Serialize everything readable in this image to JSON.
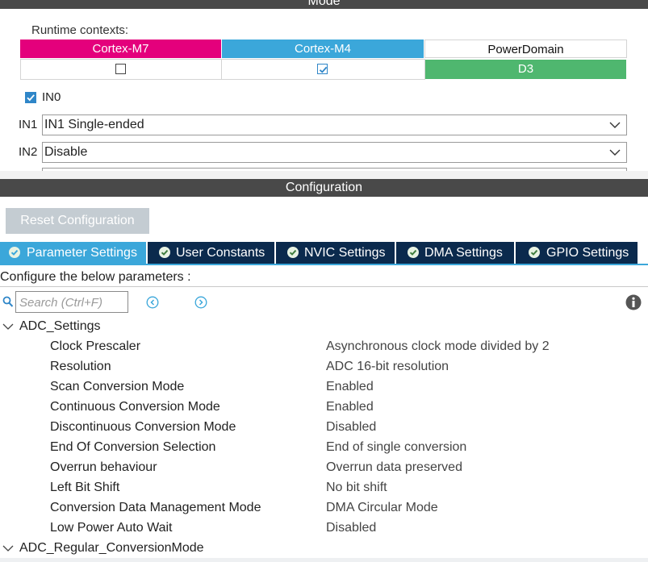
{
  "mode": {
    "title": "Mode",
    "runtime_label": "Runtime contexts:",
    "contexts": [
      {
        "name": "Cortex-M7",
        "color": "#e4007c",
        "checked": false
      },
      {
        "name": "Cortex-M4",
        "color": "#3ba7da",
        "checked": true
      },
      {
        "name": "PowerDomain",
        "value": "D3",
        "value_color": "#4fb76f"
      }
    ],
    "in0": {
      "label": "IN0",
      "checked": true
    },
    "in1": {
      "label": "IN1",
      "value": "IN1 Single-ended"
    },
    "in2": {
      "label": "IN2",
      "value": "Disable"
    }
  },
  "configuration": {
    "title": "Configuration",
    "reset_label": "Reset Configuration",
    "tabs": [
      {
        "label": "Parameter Settings",
        "active": true
      },
      {
        "label": "User Constants",
        "active": false
      },
      {
        "label": "NVIC Settings",
        "active": false
      },
      {
        "label": "DMA Settings",
        "active": false
      },
      {
        "label": "GPIO Settings",
        "active": false
      }
    ],
    "description": "Configure the below parameters :",
    "search_placeholder": "Search (Ctrl+F)",
    "groups": [
      {
        "name": "ADC_Settings",
        "expanded": true,
        "params": [
          {
            "name": "Clock Prescaler",
            "value": "Asynchronous clock mode divided by 2"
          },
          {
            "name": "Resolution",
            "value": "ADC 16-bit resolution"
          },
          {
            "name": "Scan Conversion Mode",
            "value": "Enabled"
          },
          {
            "name": "Continuous Conversion Mode",
            "value": "Enabled"
          },
          {
            "name": "Discontinuous Conversion Mode",
            "value": "Disabled"
          },
          {
            "name": "End Of Conversion Selection",
            "value": "End of single conversion"
          },
          {
            "name": "Overrun behaviour",
            "value": "Overrun data preserved"
          },
          {
            "name": "Left Bit Shift",
            "value": "No bit shift"
          },
          {
            "name": "Conversion Data Management Mode",
            "value": "DMA Circular Mode"
          },
          {
            "name": "Low Power Auto Wait",
            "value": "Disabled"
          }
        ]
      },
      {
        "name": "ADC_Regular_ConversionMode",
        "expanded": true,
        "params": []
      }
    ]
  },
  "icons": {
    "checkbox": "checkbox-icon",
    "chevron": "chevron-down-icon",
    "tab_check": "check-circle-icon",
    "search": "search-icon",
    "prev": "previous-match-icon",
    "next": "next-match-icon",
    "info": "info-icon"
  },
  "colors": {
    "header_bg": "#494949",
    "tab_bar_bg": "#0b2a4d",
    "tab_active_bg": "#3ba7da",
    "reset_bg": "#c4ccd2"
  }
}
